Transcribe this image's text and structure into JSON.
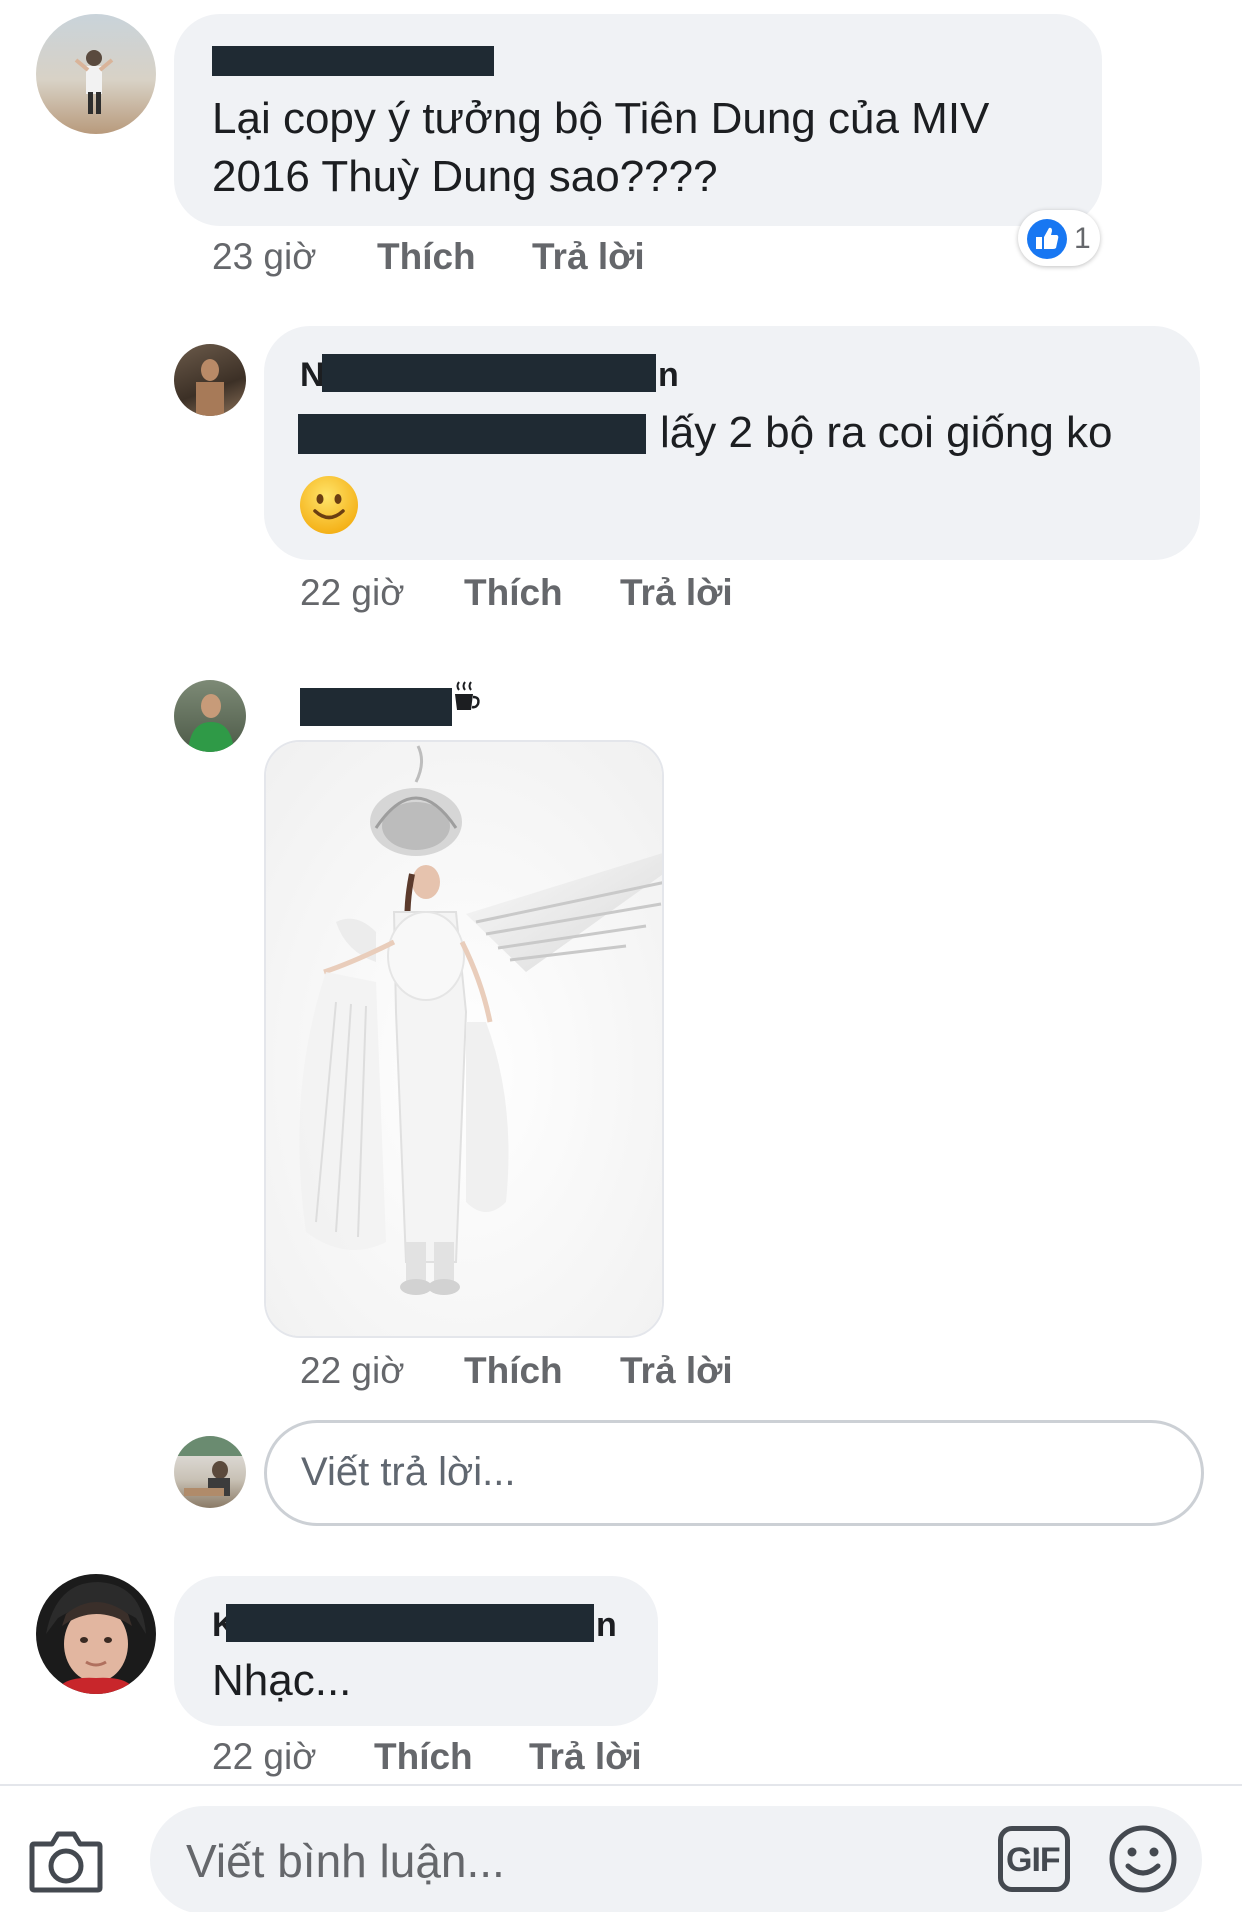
{
  "comments": [
    {
      "name_edge": "",
      "text_lines": [
        "Lại copy ý tưởng bộ Tiên Dung của MIV",
        "2016 Thuỳ Dung sao????"
      ],
      "time": "23 giờ",
      "like_label": "Thích",
      "reply_label": "Trả lời",
      "reaction_count": "1"
    }
  ],
  "replies": [
    {
      "name_edge_start": "N",
      "name_edge_end": "n",
      "text": "lấy 2 bộ ra coi giống ko",
      "emoji": "🙂",
      "time": "22 giờ",
      "like_label": "Thích",
      "reply_label": "Trả lời"
    },
    {
      "time": "22 giờ",
      "like_label": "Thích",
      "reply_label": "Trả lời"
    }
  ],
  "reply_input": {
    "placeholder": "Viết trả lời..."
  },
  "last_comment": {
    "name_edge_start": "K",
    "name_edge_end": "n",
    "text": "Nhạc...",
    "time": "22 giờ",
    "like_label": "Thích",
    "reply_label": "Trả lời"
  },
  "composer": {
    "placeholder": "Viết bình luận...",
    "gif_label": "GIF"
  },
  "colors": {
    "bubble": "#f0f2f5",
    "meta": "#65676b",
    "like_blue": "#1877f2",
    "redaction": "#1f2a33"
  }
}
